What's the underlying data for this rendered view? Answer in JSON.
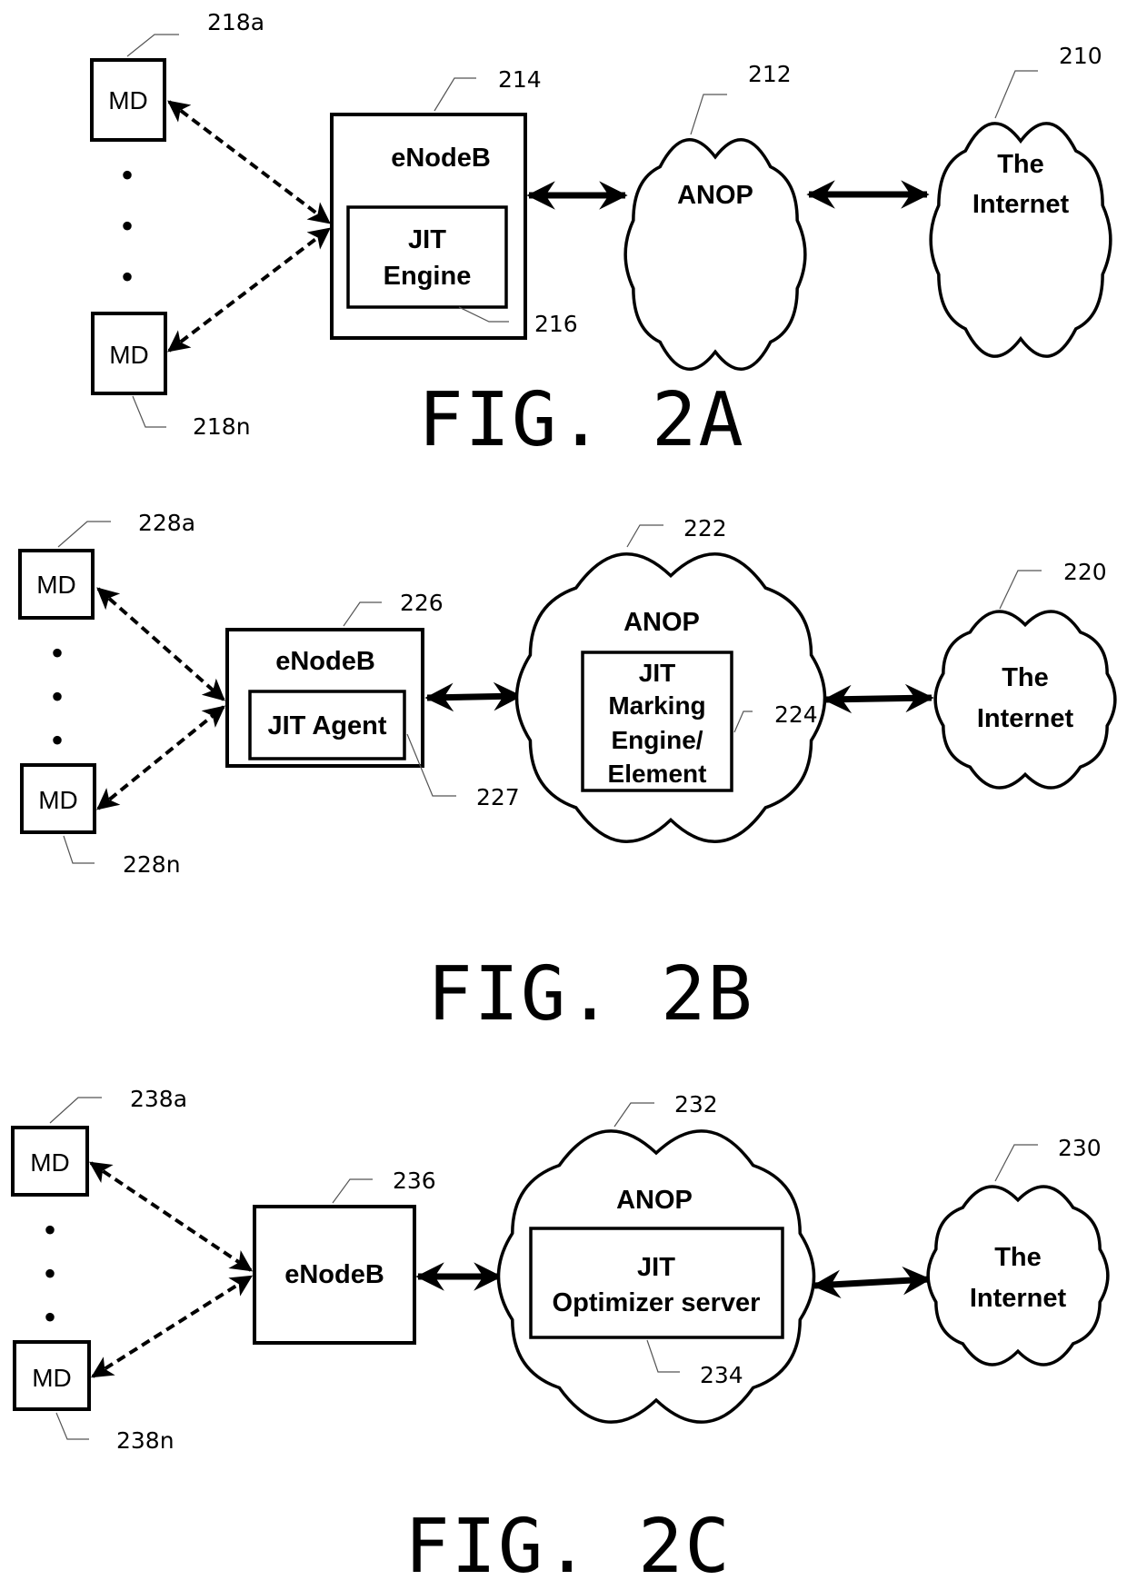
{
  "figures": [
    {
      "id": "fig2a",
      "caption": "FIG. 2A",
      "md_top": {
        "label": "MD",
        "ref": "218a"
      },
      "md_bottom": {
        "label": "MD",
        "ref": "218n"
      },
      "enodeb": {
        "label": "eNodeB",
        "ref": "214"
      },
      "enodeb_inner": {
        "lines": [
          "JIT",
          "Engine"
        ],
        "ref": "216"
      },
      "anop": {
        "label": "ANOP",
        "ref": "212"
      },
      "internet": {
        "lines": [
          "The",
          "Internet"
        ],
        "ref": "210"
      }
    },
    {
      "id": "fig2b",
      "caption": "FIG. 2B",
      "md_top": {
        "label": "MD",
        "ref": "228a"
      },
      "md_bottom": {
        "label": "MD",
        "ref": "228n"
      },
      "enodeb": {
        "label": "eNodeB",
        "ref": "226"
      },
      "enodeb_inner": {
        "lines": [
          "JIT Agent"
        ],
        "ref": "227"
      },
      "anop": {
        "label": "ANOP",
        "ref": "222"
      },
      "anop_inner": {
        "lines": [
          "JIT",
          "Marking",
          "Engine/",
          "Element"
        ],
        "ref": "224"
      },
      "internet": {
        "lines": [
          "The",
          "Internet"
        ],
        "ref": "220"
      }
    },
    {
      "id": "fig2c",
      "caption": "FIG. 2C",
      "md_top": {
        "label": "MD",
        "ref": "238a"
      },
      "md_bottom": {
        "label": "MD",
        "ref": "238n"
      },
      "enodeb": {
        "label": "eNodeB",
        "ref": "236"
      },
      "anop": {
        "label": "ANOP",
        "ref": "232"
      },
      "anop_inner": {
        "lines": [
          "JIT",
          "Optimizer server"
        ],
        "ref": "234"
      },
      "internet": {
        "lines": [
          "The",
          "Internet"
        ],
        "ref": "230"
      }
    }
  ],
  "ellipsis_glyph": "•"
}
